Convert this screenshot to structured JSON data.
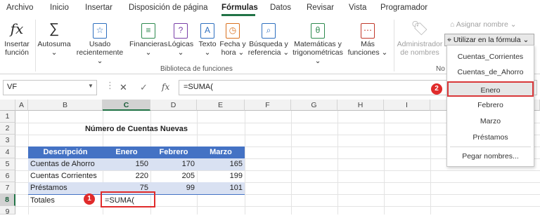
{
  "menu": {
    "tabs": [
      "Archivo",
      "Inicio",
      "Insertar",
      "Disposición de página",
      "Fórmulas",
      "Datos",
      "Revisar",
      "Vista",
      "Programador"
    ],
    "active": "Fórmulas"
  },
  "ribbon": {
    "insert_function": [
      "Insertar",
      "función"
    ],
    "autosum": [
      "Autosuma"
    ],
    "recent": [
      "Usado",
      "recientemente"
    ],
    "financial": "Financieras",
    "logical": "Lógicas",
    "text": "Texto",
    "datetime": [
      "Fecha y",
      "hora"
    ],
    "lookup": [
      "Búsqueda y",
      "referencia"
    ],
    "math": [
      "Matemáticas y",
      "trigonométricas"
    ],
    "more": [
      "Más",
      "funciones"
    ],
    "name_manager": [
      "Administrador",
      "de nombres"
    ],
    "define_name": "Asignar nombre",
    "use_in_formula": "Utilizar en la fórmula",
    "group_library": "Biblioteca de funciones",
    "group_names_partial": "No"
  },
  "formula_bar": {
    "name_box": "VF",
    "cancel_icon": "✕",
    "enter_icon": "✓",
    "fx_label": "fx",
    "formula": "=SUMA("
  },
  "grid": {
    "columns": [
      "A",
      "B",
      "C",
      "D",
      "E",
      "F",
      "G",
      "H",
      "I"
    ],
    "rows": [
      "1",
      "2",
      "3",
      "4",
      "5",
      "6",
      "7",
      "8",
      "9"
    ],
    "title": "Número de Cuentas Nuevas",
    "headers": [
      "Descripción",
      "Enero",
      "Febrero",
      "Marzo"
    ],
    "data": [
      {
        "label": "Cuentas de Ahorro",
        "v": [
          "150",
          "170",
          "165"
        ]
      },
      {
        "label": "Cuentas Corrientes",
        "v": [
          "220",
          "205",
          "199"
        ]
      },
      {
        "label": "Préstamos",
        "v": [
          "75",
          "99",
          "101"
        ]
      }
    ],
    "totals_label": "Totales",
    "active_cell_value": "=SUMA("
  },
  "dropdown": {
    "items": [
      "Cuentas_Corrientes",
      "Cuentas_de_Ahorro",
      "Enero",
      "Febrero",
      "Marzo",
      "Préstamos",
      "Pegar nombres..."
    ],
    "highlighted": "Enero"
  },
  "callouts": {
    "one": "1",
    "two": "2"
  },
  "colors": {
    "accent": "#217346",
    "header_fill": "#4472c4",
    "band_fill": "#d9e1f2",
    "callout": "#e02b2b"
  }
}
